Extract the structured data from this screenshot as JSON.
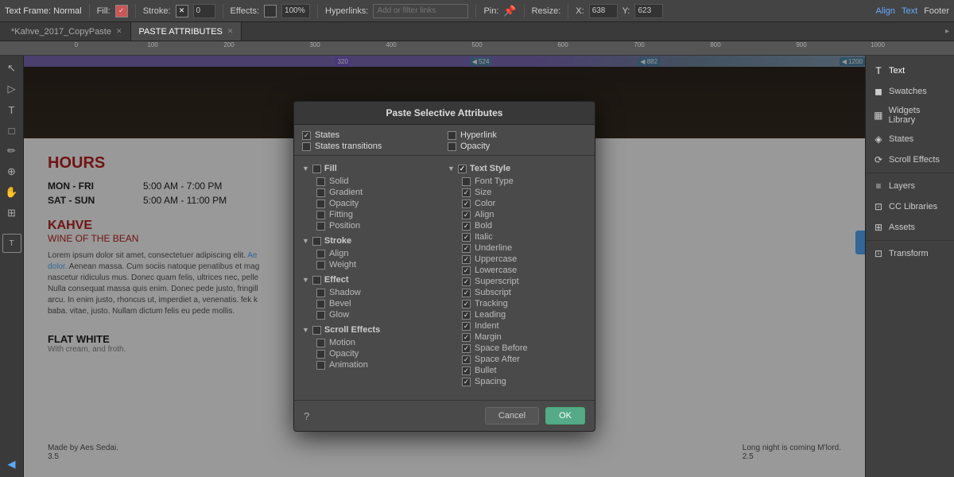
{
  "toolbar": {
    "frame_type": "Text Frame: Normal",
    "fill_label": "Fill:",
    "stroke_label": "Stroke:",
    "stroke_value": "0",
    "effects_label": "Effects:",
    "effects_value": "100%",
    "hyperlinks_label": "Hyperlinks:",
    "hyperlinks_placeholder": "Add or filter links",
    "pin_label": "Pin:",
    "resize_label": "Resize:",
    "x_label": "X:",
    "x_value": "638",
    "y_label": "Y:",
    "y_value": "623",
    "align_label": "Align",
    "text_label": "Text",
    "footer_label": "Footer"
  },
  "tabs": [
    {
      "name": "*Kahve_2017_CopyPaste",
      "active": false
    },
    {
      "name": "PASTE ATTRIBUTES",
      "active": true
    }
  ],
  "dialog": {
    "title": "Paste Selective Attributes",
    "top_left": {
      "states": {
        "label": "States",
        "checked": true
      },
      "states_transitions": {
        "label": "States transitions",
        "checked": false
      }
    },
    "top_right": {
      "hyperlink": {
        "label": "Hyperlink",
        "checked": false
      },
      "opacity": {
        "label": "Opacity",
        "checked": false
      }
    },
    "fill_section": {
      "header": "Fill",
      "items": [
        {
          "label": "Solid",
          "checked": false
        },
        {
          "label": "Gradient",
          "checked": false
        },
        {
          "label": "Opacity",
          "checked": false
        },
        {
          "label": "Fitting",
          "checked": false
        },
        {
          "label": "Position",
          "checked": false
        }
      ]
    },
    "stroke_section": {
      "header": "Stroke",
      "items": [
        {
          "label": "Align",
          "checked": false
        },
        {
          "label": "Weight",
          "checked": false
        }
      ]
    },
    "effect_section": {
      "header": "Effect",
      "items": [
        {
          "label": "Shadow",
          "checked": false
        },
        {
          "label": "Bevel",
          "checked": false
        },
        {
          "label": "Glow",
          "checked": false
        }
      ]
    },
    "scroll_effects_section": {
      "header": "Scroll Effects",
      "items": [
        {
          "label": "Motion",
          "checked": false
        },
        {
          "label": "Opacity",
          "checked": false
        },
        {
          "label": "Animation",
          "checked": false
        }
      ]
    },
    "text_style_section": {
      "header": "Text Style",
      "items": [
        {
          "label": "Font Type",
          "checked": false
        },
        {
          "label": "Size",
          "checked": true
        },
        {
          "label": "Color",
          "checked": true
        },
        {
          "label": "Align",
          "checked": true
        },
        {
          "label": "Bold",
          "checked": true
        },
        {
          "label": "Italic",
          "checked": true
        },
        {
          "label": "Underline",
          "checked": true
        },
        {
          "label": "Uppercase",
          "checked": true
        },
        {
          "label": "Lowercase",
          "checked": true
        },
        {
          "label": "Superscript",
          "checked": true
        },
        {
          "label": "Subscript",
          "checked": true
        },
        {
          "label": "Tracking",
          "checked": true
        },
        {
          "label": "Leading",
          "checked": true
        },
        {
          "label": "Indent",
          "checked": true
        },
        {
          "label": "Margin",
          "checked": true
        },
        {
          "label": "Space Before",
          "checked": true
        },
        {
          "label": "Space After",
          "checked": true
        },
        {
          "label": "Bullet",
          "checked": true
        },
        {
          "label": "Spacing",
          "checked": true
        }
      ]
    },
    "cancel_btn": "Cancel",
    "ok_btn": "OK"
  },
  "right_panel": {
    "items": [
      {
        "id": "text",
        "label": "Text",
        "icon": "T"
      },
      {
        "id": "swatches",
        "label": "Swatches",
        "icon": "◼"
      },
      {
        "id": "widgets",
        "label": "Widgets Library",
        "icon": "▦"
      },
      {
        "id": "states",
        "label": "States",
        "icon": "◈"
      },
      {
        "id": "scroll-effects",
        "label": "Scroll Effects",
        "icon": "⟳"
      },
      {
        "id": "sep",
        "label": "",
        "icon": ""
      },
      {
        "id": "layers",
        "label": "Layers",
        "icon": "≡"
      },
      {
        "id": "cc-libraries",
        "label": "CC Libraries",
        "icon": "⊡"
      },
      {
        "id": "assets",
        "label": "Assets",
        "icon": "⊞"
      },
      {
        "id": "sep2",
        "label": "",
        "icon": ""
      },
      {
        "id": "transform",
        "label": "Transform",
        "icon": "⊡"
      }
    ]
  },
  "page": {
    "hours_title": "HOURS",
    "hours_rows": [
      {
        "days": "MON - FRI",
        "hours": "5:00 AM - 7:00 PM"
      },
      {
        "days": "SAT - SUN",
        "hours": "5:00 AM - 11:00 PM"
      }
    ],
    "kahve_title": "KAHVE",
    "kahve_sub": "WINE OF THE BEAN",
    "lorem": "Lorem ipsum dolor sit amet, consectetuer adipiscing elit. Ae dolor. Aenean massa. Cum sociis natoque penatibus et mag nascetur ridiculus mus. Donec quam felis, ultrices nec, pelle Nulla consequat massa quis enim. Donec pede justo, fringill arcu. In enim justo, rhoncus ut, imperdiet a, venenatis. fek k baba. vitae, justo. Nullam dictum felis eu pede mollis.",
    "flat_white_title": "FLAT WHITE",
    "flat_white_sub": "With cream, and froth.",
    "credit1_name": "Made by Aes Sedai.",
    "credit1_num": "3.5",
    "credit2_text": "Long night is coming M'lord.",
    "credit2_num": "2.5"
  }
}
